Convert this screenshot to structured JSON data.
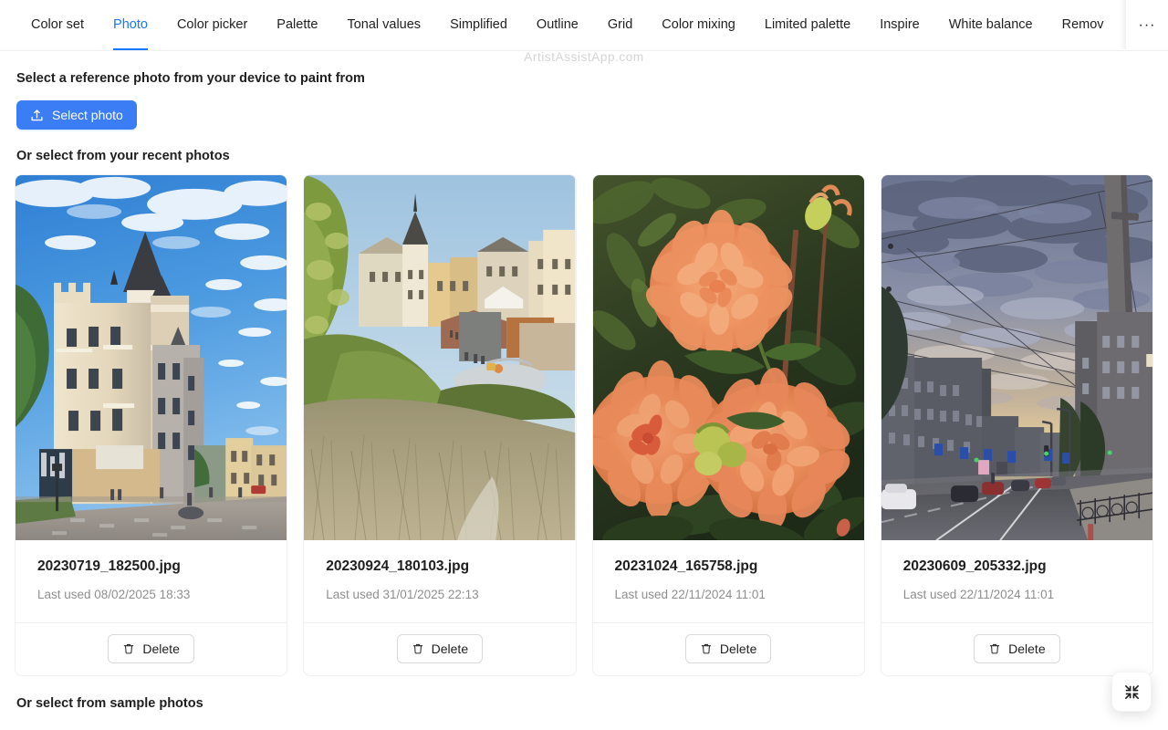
{
  "app": {
    "watermark": "ArtistAssistApp.com",
    "accent_color": "#1677ff",
    "primary_button_color": "#3b7df5"
  },
  "tabs": {
    "items": [
      {
        "label": "Color set",
        "active": false
      },
      {
        "label": "Photo",
        "active": true
      },
      {
        "label": "Color picker",
        "active": false
      },
      {
        "label": "Palette",
        "active": false
      },
      {
        "label": "Tonal values",
        "active": false
      },
      {
        "label": "Simplified",
        "active": false
      },
      {
        "label": "Outline",
        "active": false
      },
      {
        "label": "Grid",
        "active": false
      },
      {
        "label": "Color mixing",
        "active": false
      },
      {
        "label": "Limited palette",
        "active": false
      },
      {
        "label": "Inspire",
        "active": false
      },
      {
        "label": "White balance",
        "active": false
      },
      {
        "label": "Remov",
        "active": false
      }
    ],
    "more_label": "···"
  },
  "main": {
    "lead": "Select a reference photo from your device to paint from",
    "select_photo_label": "Select photo",
    "recent_heading": "Or select from your recent photos",
    "sample_heading": "Or select from sample photos",
    "delete_label": "Delete"
  },
  "photos": [
    {
      "filename": "20230719_182500.jpg",
      "meta": "Last used 08/02/2025 18:33",
      "delete_label": "Delete",
      "scene": "castle-street"
    },
    {
      "filename": "20230924_180103.jpg",
      "meta": "Last used 31/01/2025 22:13",
      "delete_label": "Delete",
      "scene": "hillside-town"
    },
    {
      "filename": "20231024_165758.jpg",
      "meta": "Last used 22/11/2024 11:01",
      "delete_label": "Delete",
      "scene": "orange-dahlias"
    },
    {
      "filename": "20230609_205332.jpg",
      "meta": "Last used 22/11/2024 11:01",
      "delete_label": "Delete",
      "scene": "sunset-street"
    }
  ],
  "fab": {
    "icon": "compress-icon"
  }
}
